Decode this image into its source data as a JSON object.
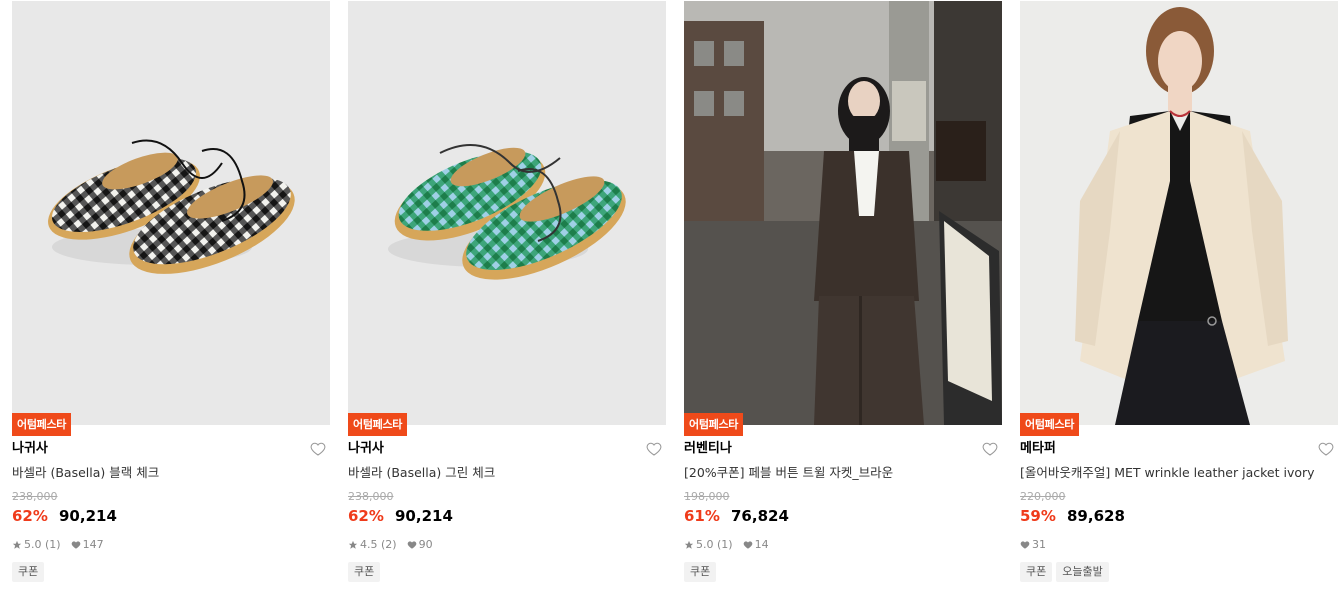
{
  "products": [
    {
      "image": "gingham-espadrille-black-photo",
      "badge": "어텀페스타",
      "brand": "나귀사",
      "name": "바셀라 (Basella) 블랙 체크",
      "original_price": "238,000",
      "discount": "62%",
      "price": "90,214",
      "rating": "5.0 (1)",
      "likes": "147",
      "tags": [
        "쿠폰"
      ]
    },
    {
      "image": "gingham-espadrille-green-photo",
      "badge": "어텀페스타",
      "brand": "나귀사",
      "name": "바셀라 (Basella) 그린 체크",
      "original_price": "238,000",
      "discount": "62%",
      "price": "90,214",
      "rating": "4.5 (2)",
      "likes": "90",
      "tags": [
        "쿠폰"
      ]
    },
    {
      "image": "brown-tweed-jacket-model-photo",
      "badge": "어텀페스타",
      "brand": "러벤티나",
      "name": "[20%쿠폰] 페블 버튼 트윌 자켓_브라운",
      "original_price": "198,000",
      "discount": "61%",
      "price": "76,824",
      "rating": "5.0 (1)",
      "likes": "14",
      "tags": [
        "쿠폰"
      ]
    },
    {
      "image": "ivory-leather-jacket-model-photo",
      "badge": "어텀페스타",
      "brand": "메타퍼",
      "name": "[올어바웃캐주얼] MET wrinkle leather jacket ivory",
      "original_price": "220,000",
      "discount": "59%",
      "price": "89,628",
      "rating": "",
      "likes": "31",
      "tags": [
        "쿠폰",
        "오늘출발"
      ]
    }
  ],
  "colors": {
    "badge": "#ef4a1a",
    "discount": "#ef3b1b"
  }
}
